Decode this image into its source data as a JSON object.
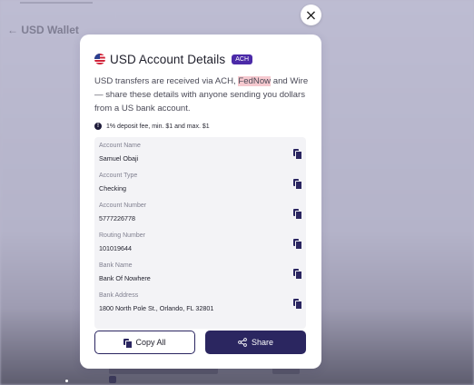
{
  "background": {
    "page_title": "USD Wallet"
  },
  "modal": {
    "title": "USD Account Details",
    "badge": "ACH",
    "description": {
      "before": "USD transfers are received via ACH, ",
      "highlight": "FedNow",
      "after": " and Wire — share these details with anyone sending you dollars from a US bank account."
    },
    "fee_note": "1% deposit fee, min. $1 and max. $1",
    "details": [
      {
        "label": "Account Name",
        "value": "Samuel Obaji"
      },
      {
        "label": "Account Type",
        "value": "Checking"
      },
      {
        "label": "Account Number",
        "value": "5777226778"
      },
      {
        "label": "Routing Number",
        "value": "101019644"
      },
      {
        "label": "Bank Name",
        "value": "Bank Of Nowhere"
      },
      {
        "label": "Bank Address",
        "value": "1800 North Pole St., Orlando, FL 32801"
      }
    ],
    "buttons": {
      "copy_all": "Copy All",
      "share": "Share"
    }
  },
  "close_label": "×",
  "colors": {
    "accent": "#2b2660",
    "badge": "#4b2aa8",
    "highlight": "#f6c9cf",
    "overlay": "#b9b8cd"
  },
  "icons": [
    "close-icon",
    "us-flag-icon",
    "info-icon",
    "copy-icon",
    "share-icon"
  ]
}
